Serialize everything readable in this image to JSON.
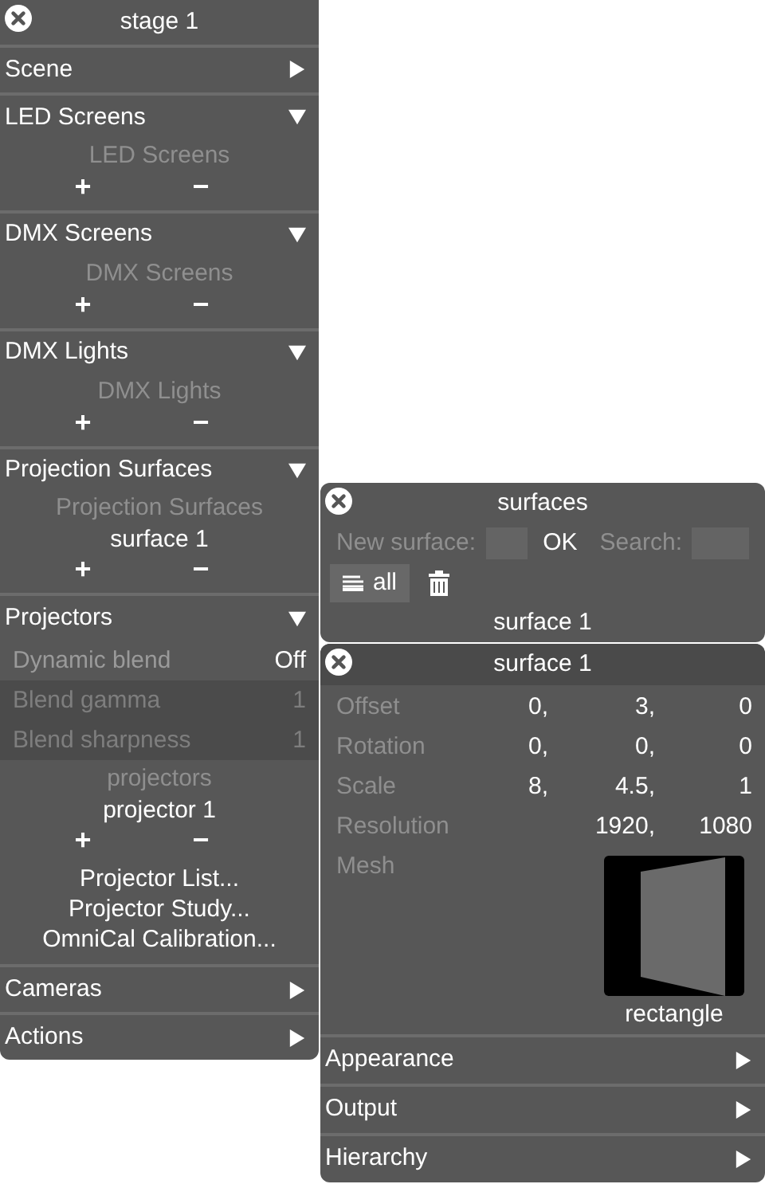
{
  "stage_panel": {
    "title": "stage 1",
    "sections": [
      {
        "title": "Scene",
        "expanded": false
      },
      {
        "title": "LED Screens",
        "expanded": true,
        "list": {
          "label": "LED Screens",
          "add": "+",
          "remove": "−"
        }
      },
      {
        "title": "DMX Screens",
        "expanded": true,
        "list": {
          "label": "DMX Screens",
          "add": "+",
          "remove": "−"
        }
      },
      {
        "title": "DMX Lights",
        "expanded": true,
        "list": {
          "label": "DMX Lights",
          "add": "+",
          "remove": "−"
        }
      },
      {
        "title": "Projection Surfaces",
        "expanded": true,
        "list": {
          "label": "Projection Surfaces",
          "items": [
            "surface 1"
          ],
          "add": "+",
          "remove": "−"
        }
      },
      {
        "title": "Projectors",
        "expanded": true,
        "settings": [
          {
            "label": "Dynamic blend",
            "value": "Off",
            "disabled": false
          },
          {
            "label": "Blend gamma",
            "value": "1",
            "disabled": true
          },
          {
            "label": "Blend sharpness",
            "value": "1",
            "disabled": true
          }
        ],
        "list": {
          "label": "projectors",
          "items": [
            "projector 1"
          ],
          "add": "+",
          "remove": "−"
        },
        "links": [
          "Projector List...",
          "Projector Study...",
          "OmniCal Calibration..."
        ]
      },
      {
        "title": "Cameras",
        "expanded": false
      },
      {
        "title": "Actions",
        "expanded": false
      }
    ]
  },
  "surfaces_panel": {
    "title": "surfaces",
    "new_label": "New surface:",
    "ok_button": "OK",
    "search_label": "Search:",
    "filter_button": {
      "label": "all",
      "selected": true
    },
    "items": [
      "surface 1"
    ]
  },
  "surface_panel": {
    "title": "surface 1",
    "properties": [
      {
        "label": "Offset",
        "values": [
          "0,",
          "3,",
          "0"
        ]
      },
      {
        "label": "Rotation",
        "values": [
          "0,",
          "0,",
          "0"
        ]
      },
      {
        "label": "Scale",
        "values": [
          "8,",
          "4.5,",
          "1"
        ]
      },
      {
        "label": "Resolution",
        "values": [
          "1920,",
          "1080"
        ]
      }
    ],
    "mesh": {
      "label": "Mesh",
      "caption": "rectangle"
    },
    "sections": [
      {
        "title": "Appearance",
        "expanded": false
      },
      {
        "title": "Output",
        "expanded": false
      },
      {
        "title": "Hierarchy",
        "expanded": false
      }
    ]
  }
}
